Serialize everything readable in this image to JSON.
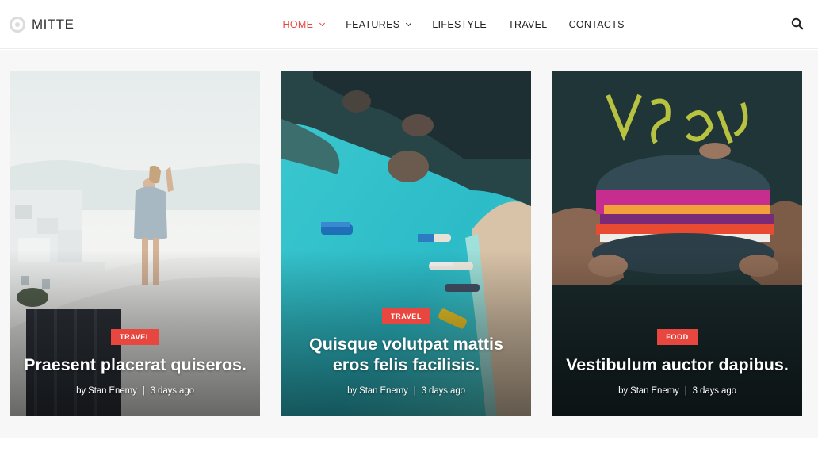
{
  "site": {
    "logo_text": "MITTE",
    "nav": [
      {
        "label": "HOME",
        "active": true,
        "dropdown": true
      },
      {
        "label": "FEATURES",
        "active": false,
        "dropdown": true
      },
      {
        "label": "LIFESTYLE",
        "active": false,
        "dropdown": false
      },
      {
        "label": "TRAVEL",
        "active": false,
        "dropdown": false
      },
      {
        "label": "CONTACTS",
        "active": false,
        "dropdown": false
      }
    ],
    "search_icon": "search-icon",
    "accent_color": "#e8473f"
  },
  "featured": [
    {
      "category": "TRAVEL",
      "title": "Praesent placerat quiseros.",
      "author": "by Stan Enemy",
      "date": "3 days ago",
      "image": "woman standing on white rooftop overlooking sea"
    },
    {
      "category": "TRAVEL",
      "title": "Quisque volutpat mattis eros felis facilisis.",
      "author": "by Stan Enemy",
      "date": "3 days ago",
      "image": "aerial view of turquoise bay with boats"
    },
    {
      "category": "FOOD",
      "title": "Vestibulum auctor dapibus.",
      "author": "by Stan Enemy",
      "date": "3 days ago",
      "image": "hands holding colorful vegan sandwich"
    }
  ]
}
